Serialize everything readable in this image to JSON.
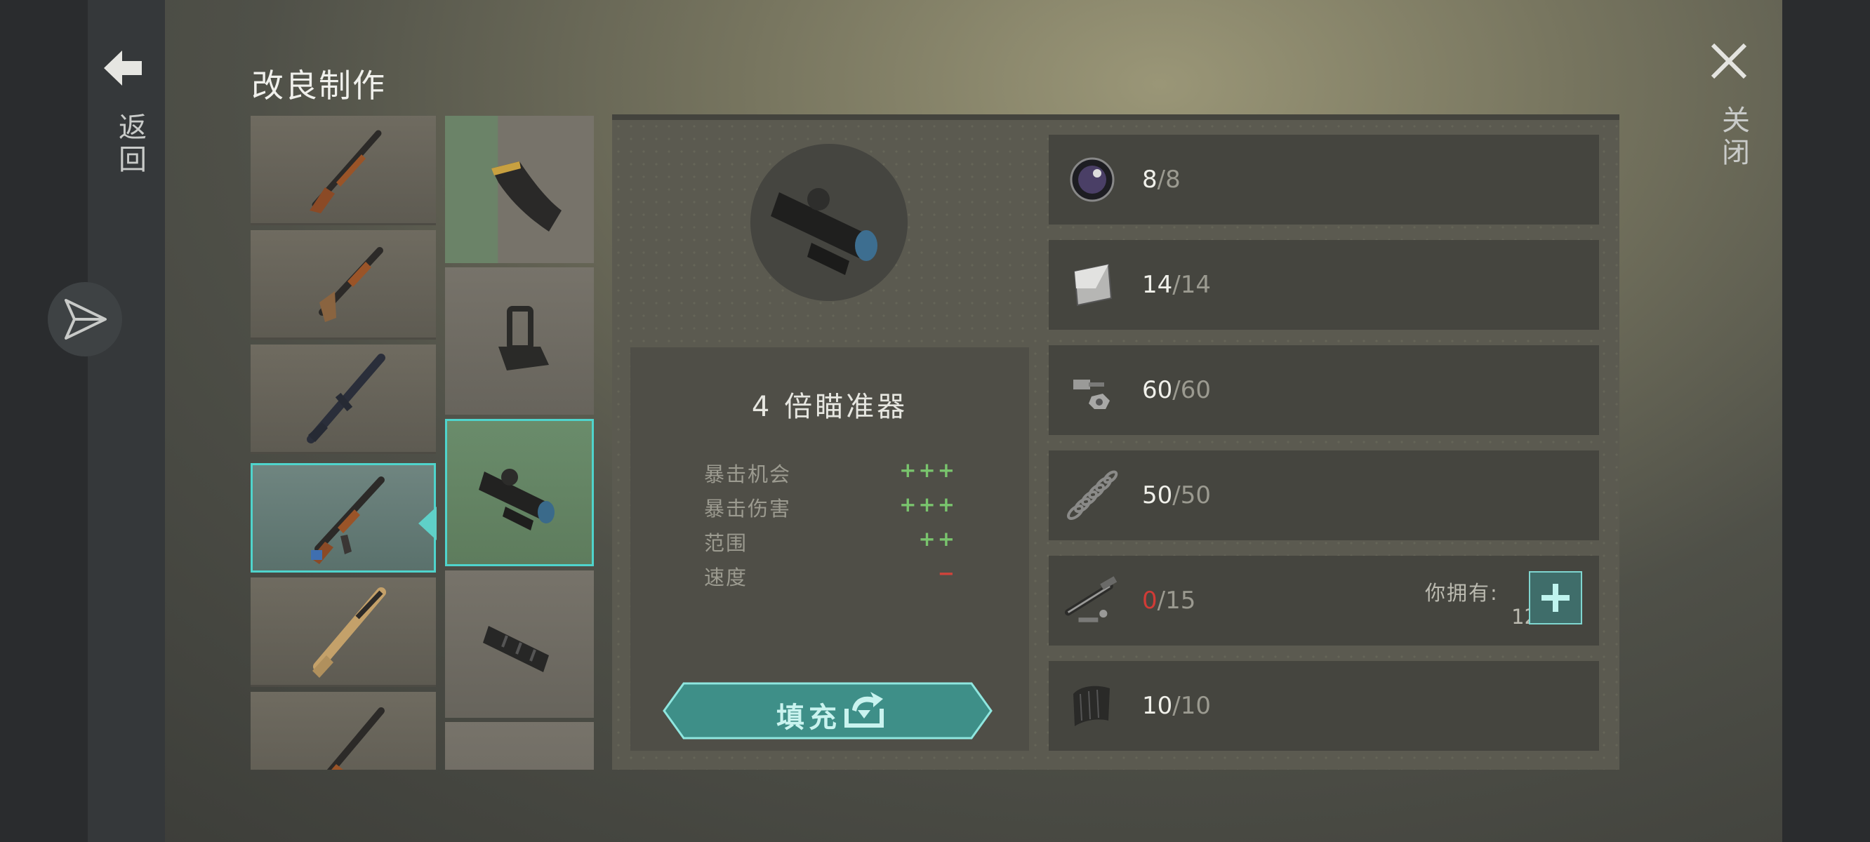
{
  "header": {
    "title": "改良制作"
  },
  "nav": {
    "back_label": "返回",
    "close_label": "关闭"
  },
  "weapons": [
    {
      "name": "lever-action-rifle",
      "selected": false
    },
    {
      "name": "pump-shotgun",
      "selected": false
    },
    {
      "name": "m16-rifle",
      "selected": false
    },
    {
      "name": "ak-rifle",
      "selected": true
    },
    {
      "name": "scar-rifle",
      "selected": false
    },
    {
      "name": "bolt-rifle",
      "selected": false
    }
  ],
  "mods": [
    {
      "name": "magazine",
      "selected": false
    },
    {
      "name": "iron-sight",
      "selected": false
    },
    {
      "name": "4x-scope",
      "selected": true
    },
    {
      "name": "muzzle-brake",
      "selected": false
    },
    {
      "name": "partial-item",
      "selected": false
    }
  ],
  "item": {
    "name": "4 倍瞄准器",
    "stats": [
      {
        "label": "暴击机会",
        "value": "+++",
        "positive": true
      },
      {
        "label": "暴击伤害",
        "value": "+++",
        "positive": true
      },
      {
        "label": "范围",
        "value": "++",
        "positive": true
      },
      {
        "label": "速度",
        "value": "−",
        "positive": false
      }
    ],
    "fill_button": "填充"
  },
  "resources": [
    {
      "icon": "lens-icon",
      "have": "8",
      "need": "/8",
      "short": false
    },
    {
      "icon": "metal-sheet-icon",
      "have": "14",
      "need": "/14",
      "short": false
    },
    {
      "icon": "bolts-nuts-icon",
      "have": "60",
      "need": "/60",
      "short": false
    },
    {
      "icon": "spring-icon",
      "have": "50",
      "need": "/50",
      "short": false
    },
    {
      "icon": "weapon-parts-icon",
      "have": "0",
      "need": "/15",
      "short": true,
      "own_label": "你拥有:",
      "own_value": "12"
    },
    {
      "icon": "rubber-icon",
      "have": "10",
      "need": "/10",
      "short": false
    }
  ],
  "colors": {
    "accent": "#4fd4cc",
    "positive": "#79c46d",
    "negative": "#d0433b"
  }
}
